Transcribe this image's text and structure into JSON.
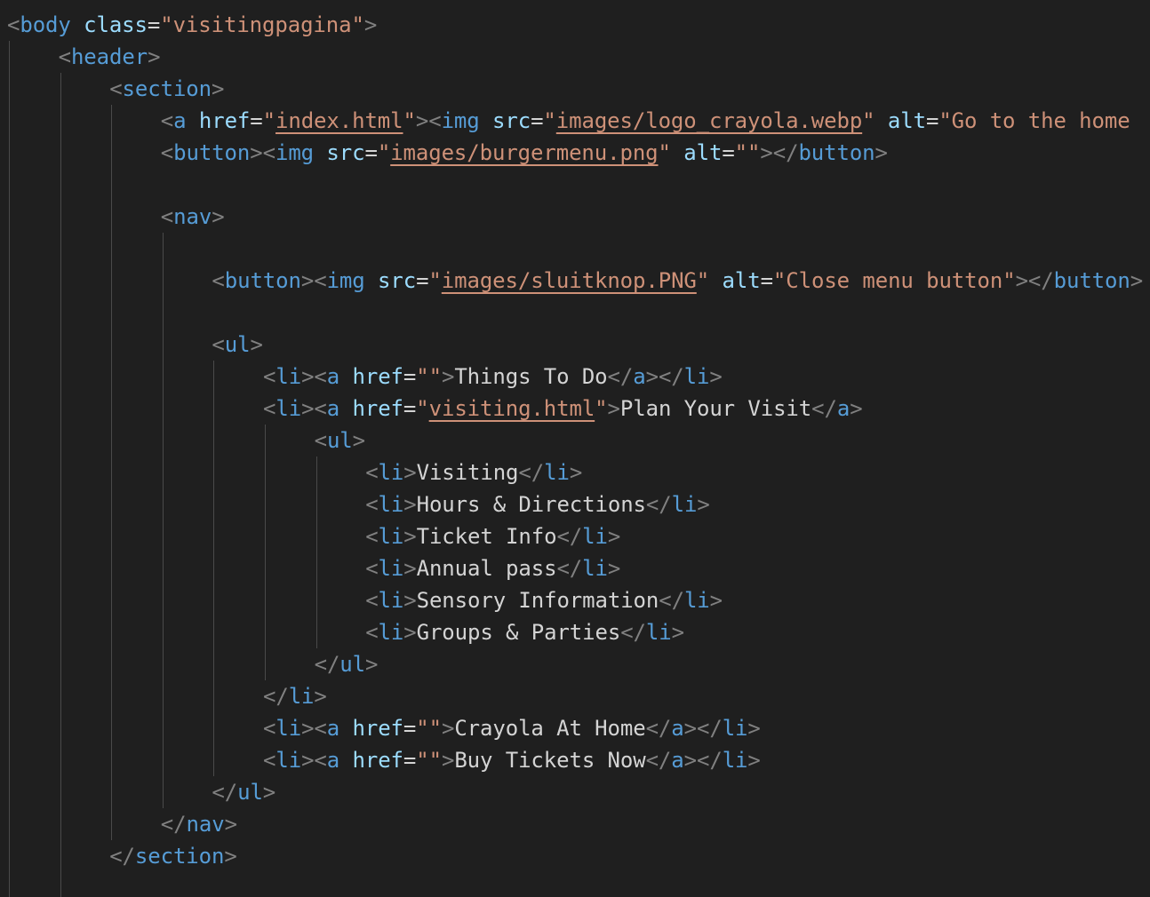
{
  "editor": {
    "theme": {
      "background": "#1f1f1f",
      "punctuation": "#808080",
      "tag": "#569cd6",
      "attribute": "#9cdcfe",
      "string": "#ce9178",
      "text": "#d4d4d4",
      "indent_guide": "#4a4a4a"
    },
    "lines": [
      {
        "indent": 0,
        "tokens": [
          [
            "p",
            "<"
          ],
          [
            "n",
            "body"
          ],
          [
            "o",
            " "
          ],
          [
            "a",
            "class"
          ],
          [
            "o",
            "="
          ],
          [
            "s",
            "\"visitingpagina\""
          ],
          [
            "p",
            ">"
          ]
        ]
      },
      {
        "indent": 1,
        "tokens": [
          [
            "p",
            "<"
          ],
          [
            "n",
            "header"
          ],
          [
            "p",
            ">"
          ]
        ]
      },
      {
        "indent": 2,
        "tokens": [
          [
            "p",
            "<"
          ],
          [
            "n",
            "section"
          ],
          [
            "p",
            ">"
          ]
        ]
      },
      {
        "indent": 3,
        "tokens": [
          [
            "p",
            "<"
          ],
          [
            "n",
            "a"
          ],
          [
            "o",
            " "
          ],
          [
            "a",
            "href"
          ],
          [
            "o",
            "="
          ],
          [
            "s",
            "\""
          ],
          [
            "u",
            "index.html"
          ],
          [
            "s",
            "\""
          ],
          [
            "p",
            ">"
          ],
          [
            "p",
            "<"
          ],
          [
            "n",
            "img"
          ],
          [
            "o",
            " "
          ],
          [
            "a",
            "src"
          ],
          [
            "o",
            "="
          ],
          [
            "s",
            "\""
          ],
          [
            "u",
            "images/logo_crayola.webp"
          ],
          [
            "s",
            "\""
          ],
          [
            "o",
            " "
          ],
          [
            "a",
            "alt"
          ],
          [
            "o",
            "="
          ],
          [
            "s",
            "\"Go to the home"
          ]
        ]
      },
      {
        "indent": 3,
        "tokens": [
          [
            "p",
            "<"
          ],
          [
            "n",
            "button"
          ],
          [
            "p",
            ">"
          ],
          [
            "p",
            "<"
          ],
          [
            "n",
            "img"
          ],
          [
            "o",
            " "
          ],
          [
            "a",
            "src"
          ],
          [
            "o",
            "="
          ],
          [
            "s",
            "\""
          ],
          [
            "u",
            "images/burgermenu.png"
          ],
          [
            "s",
            "\""
          ],
          [
            "o",
            " "
          ],
          [
            "a",
            "alt"
          ],
          [
            "o",
            "="
          ],
          [
            "s",
            "\"\""
          ],
          [
            "p",
            ">"
          ],
          [
            "p",
            "</"
          ],
          [
            "n",
            "button"
          ],
          [
            "p",
            ">"
          ]
        ]
      },
      {
        "indent": 3,
        "tokens": []
      },
      {
        "indent": 3,
        "tokens": [
          [
            "p",
            "<"
          ],
          [
            "n",
            "nav"
          ],
          [
            "p",
            ">"
          ]
        ]
      },
      {
        "indent": 4,
        "tokens": []
      },
      {
        "indent": 4,
        "tokens": [
          [
            "p",
            "<"
          ],
          [
            "n",
            "button"
          ],
          [
            "p",
            ">"
          ],
          [
            "p",
            "<"
          ],
          [
            "n",
            "img"
          ],
          [
            "o",
            " "
          ],
          [
            "a",
            "src"
          ],
          [
            "o",
            "="
          ],
          [
            "s",
            "\""
          ],
          [
            "u",
            "images/sluitknop.PNG"
          ],
          [
            "s",
            "\""
          ],
          [
            "o",
            " "
          ],
          [
            "a",
            "alt"
          ],
          [
            "o",
            "="
          ],
          [
            "s",
            "\"Close menu button\""
          ],
          [
            "p",
            ">"
          ],
          [
            "p",
            "</"
          ],
          [
            "n",
            "button"
          ],
          [
            "p",
            ">"
          ]
        ]
      },
      {
        "indent": 4,
        "tokens": []
      },
      {
        "indent": 4,
        "tokens": [
          [
            "p",
            "<"
          ],
          [
            "n",
            "ul"
          ],
          [
            "p",
            ">"
          ]
        ]
      },
      {
        "indent": 5,
        "tokens": [
          [
            "p",
            "<"
          ],
          [
            "n",
            "li"
          ],
          [
            "p",
            ">"
          ],
          [
            "p",
            "<"
          ],
          [
            "n",
            "a"
          ],
          [
            "o",
            " "
          ],
          [
            "a",
            "href"
          ],
          [
            "o",
            "="
          ],
          [
            "s",
            "\"\""
          ],
          [
            "p",
            ">"
          ],
          [
            "x",
            "Things To Do"
          ],
          [
            "p",
            "</"
          ],
          [
            "n",
            "a"
          ],
          [
            "p",
            ">"
          ],
          [
            "p",
            "</"
          ],
          [
            "n",
            "li"
          ],
          [
            "p",
            ">"
          ]
        ]
      },
      {
        "indent": 5,
        "tokens": [
          [
            "p",
            "<"
          ],
          [
            "n",
            "li"
          ],
          [
            "p",
            ">"
          ],
          [
            "p",
            "<"
          ],
          [
            "n",
            "a"
          ],
          [
            "o",
            " "
          ],
          [
            "a",
            "href"
          ],
          [
            "o",
            "="
          ],
          [
            "s",
            "\""
          ],
          [
            "u",
            "visiting.html"
          ],
          [
            "s",
            "\""
          ],
          [
            "p",
            ">"
          ],
          [
            "x",
            "Plan Your Visit"
          ],
          [
            "p",
            "</"
          ],
          [
            "n",
            "a"
          ],
          [
            "p",
            ">"
          ]
        ]
      },
      {
        "indent": 6,
        "tokens": [
          [
            "p",
            "<"
          ],
          [
            "n",
            "ul"
          ],
          [
            "p",
            ">"
          ]
        ]
      },
      {
        "indent": 7,
        "tokens": [
          [
            "p",
            "<"
          ],
          [
            "n",
            "li"
          ],
          [
            "p",
            ">"
          ],
          [
            "x",
            "Visiting"
          ],
          [
            "p",
            "</"
          ],
          [
            "n",
            "li"
          ],
          [
            "p",
            ">"
          ]
        ]
      },
      {
        "indent": 7,
        "tokens": [
          [
            "p",
            "<"
          ],
          [
            "n",
            "li"
          ],
          [
            "p",
            ">"
          ],
          [
            "x",
            "Hours & Directions"
          ],
          [
            "p",
            "</"
          ],
          [
            "n",
            "li"
          ],
          [
            "p",
            ">"
          ]
        ]
      },
      {
        "indent": 7,
        "tokens": [
          [
            "p",
            "<"
          ],
          [
            "n",
            "li"
          ],
          [
            "p",
            ">"
          ],
          [
            "x",
            "Ticket Info"
          ],
          [
            "p",
            "</"
          ],
          [
            "n",
            "li"
          ],
          [
            "p",
            ">"
          ]
        ]
      },
      {
        "indent": 7,
        "tokens": [
          [
            "p",
            "<"
          ],
          [
            "n",
            "li"
          ],
          [
            "p",
            ">"
          ],
          [
            "x",
            "Annual pass"
          ],
          [
            "p",
            "</"
          ],
          [
            "n",
            "li"
          ],
          [
            "p",
            ">"
          ]
        ]
      },
      {
        "indent": 7,
        "tokens": [
          [
            "p",
            "<"
          ],
          [
            "n",
            "li"
          ],
          [
            "p",
            ">"
          ],
          [
            "x",
            "Sensory Information"
          ],
          [
            "p",
            "</"
          ],
          [
            "n",
            "li"
          ],
          [
            "p",
            ">"
          ]
        ]
      },
      {
        "indent": 7,
        "tokens": [
          [
            "p",
            "<"
          ],
          [
            "n",
            "li"
          ],
          [
            "p",
            ">"
          ],
          [
            "x",
            "Groups & Parties"
          ],
          [
            "p",
            "</"
          ],
          [
            "n",
            "li"
          ],
          [
            "p",
            ">"
          ]
        ]
      },
      {
        "indent": 6,
        "tokens": [
          [
            "p",
            "</"
          ],
          [
            "n",
            "ul"
          ],
          [
            "p",
            ">"
          ]
        ]
      },
      {
        "indent": 5,
        "tokens": [
          [
            "p",
            "</"
          ],
          [
            "n",
            "li"
          ],
          [
            "p",
            ">"
          ]
        ]
      },
      {
        "indent": 5,
        "tokens": [
          [
            "p",
            "<"
          ],
          [
            "n",
            "li"
          ],
          [
            "p",
            ">"
          ],
          [
            "p",
            "<"
          ],
          [
            "n",
            "a"
          ],
          [
            "o",
            " "
          ],
          [
            "a",
            "href"
          ],
          [
            "o",
            "="
          ],
          [
            "s",
            "\"\""
          ],
          [
            "p",
            ">"
          ],
          [
            "x",
            "Crayola At Home"
          ],
          [
            "p",
            "</"
          ],
          [
            "n",
            "a"
          ],
          [
            "p",
            ">"
          ],
          [
            "p",
            "</"
          ],
          [
            "n",
            "li"
          ],
          [
            "p",
            ">"
          ]
        ]
      },
      {
        "indent": 5,
        "tokens": [
          [
            "p",
            "<"
          ],
          [
            "n",
            "li"
          ],
          [
            "p",
            ">"
          ],
          [
            "p",
            "<"
          ],
          [
            "n",
            "a"
          ],
          [
            "o",
            " "
          ],
          [
            "a",
            "href"
          ],
          [
            "o",
            "="
          ],
          [
            "s",
            "\"\""
          ],
          [
            "p",
            ">"
          ],
          [
            "x",
            "Buy Tickets Now"
          ],
          [
            "p",
            "</"
          ],
          [
            "n",
            "a"
          ],
          [
            "p",
            ">"
          ],
          [
            "p",
            "</"
          ],
          [
            "n",
            "li"
          ],
          [
            "p",
            ">"
          ]
        ]
      },
      {
        "indent": 4,
        "tokens": [
          [
            "p",
            "</"
          ],
          [
            "n",
            "ul"
          ],
          [
            "p",
            ">"
          ]
        ]
      },
      {
        "indent": 3,
        "tokens": [
          [
            "p",
            "</"
          ],
          [
            "n",
            "nav"
          ],
          [
            "p",
            ">"
          ]
        ]
      },
      {
        "indent": 2,
        "tokens": [
          [
            "p",
            "</"
          ],
          [
            "n",
            "section"
          ],
          [
            "p",
            ">"
          ]
        ]
      },
      {
        "indent": 2,
        "tokens": []
      }
    ]
  }
}
